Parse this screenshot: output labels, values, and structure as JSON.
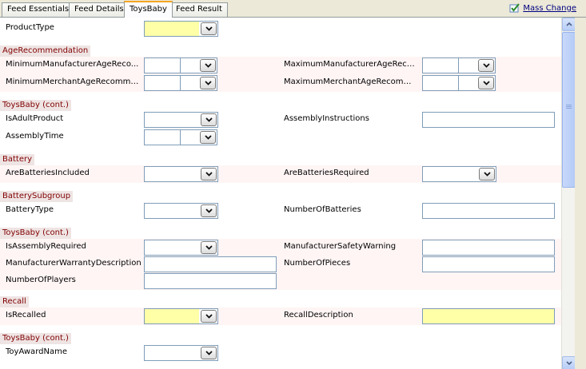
{
  "tabs": [
    {
      "label": "Feed Essentials",
      "active": false
    },
    {
      "label": "Feed Details",
      "active": false
    },
    {
      "label": "ToysBaby",
      "active": true
    },
    {
      "label": "Feed Result",
      "active": false
    }
  ],
  "mass_change": {
    "label": "Mass Change",
    "icon": "check-edit-icon"
  },
  "rows": {
    "product_type": "ProductType",
    "min_mfr_age": "MinimumManufacturerAgeReco...",
    "max_mfr_age": "MaximumManufacturerAgeReco...",
    "min_merch_age": "MinimumMerchantAgeRecomme...",
    "max_merch_age": "MaximumMerchantAgeRecomme...",
    "is_adult": "IsAdultProduct",
    "assembly_instructions": "AssemblyInstructions",
    "assembly_time": "AssemblyTime",
    "batteries_included": "AreBatteriesIncluded",
    "batteries_required": "AreBatteriesRequired",
    "battery_type": "BatteryType",
    "number_of_batteries": "NumberOfBatteries",
    "is_assembly_required": "IsAssemblyRequired",
    "mfr_safety_warning": "ManufacturerSafetyWarning",
    "mfr_warranty_description": "ManufacturerWarrantyDescription",
    "number_of_pieces": "NumberOfPieces",
    "number_of_players": "NumberOfPlayers",
    "is_recalled": "IsRecalled",
    "recall_description": "RecallDescription",
    "toy_award_name": "ToyAwardName"
  },
  "sections": {
    "age_recommendation": "AgeRecommendation",
    "toysbaby_cont_1": "ToysBaby (cont.)",
    "battery": "Battery",
    "battery_subgroup": "BatterySubgroup",
    "toysbaby_cont_2": "ToysBaby (cont.)",
    "recall": "Recall",
    "toysbaby_cont_3": "ToysBaby (cont.)"
  },
  "colors": {
    "section_text": "#800000",
    "required_field": "#ffffa8",
    "active_tab_accent": "#f5a623",
    "link": "#000080"
  }
}
